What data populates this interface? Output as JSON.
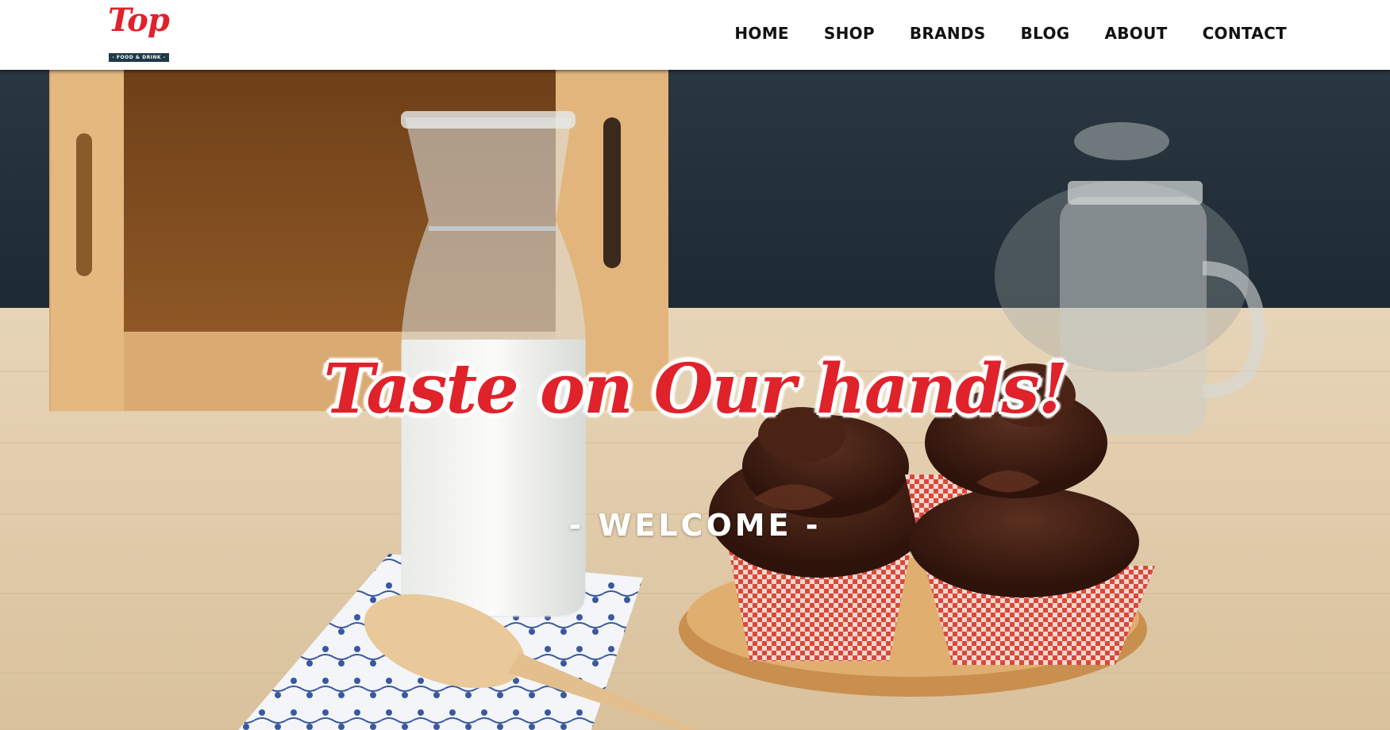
{
  "brand": {
    "logo_script": "Top",
    "logo_tagline": "- FOOD & DRINK -"
  },
  "nav": {
    "items": [
      {
        "label": "HOME"
      },
      {
        "label": "SHOP"
      },
      {
        "label": "BRANDS"
      },
      {
        "label": "BLOG"
      },
      {
        "label": "ABOUT"
      },
      {
        "label": "CONTACT"
      }
    ]
  },
  "hero": {
    "headline": "Taste on Our hands!",
    "subheading": "- WELCOME -",
    "image": "photo of glass milk carafe, wooden spoon, napkin and chocolate cupcakes on a wooden board"
  },
  "colors": {
    "accent": "#e0222b",
    "logo_bar": "#1d3a4a",
    "nav_text": "#111111"
  }
}
